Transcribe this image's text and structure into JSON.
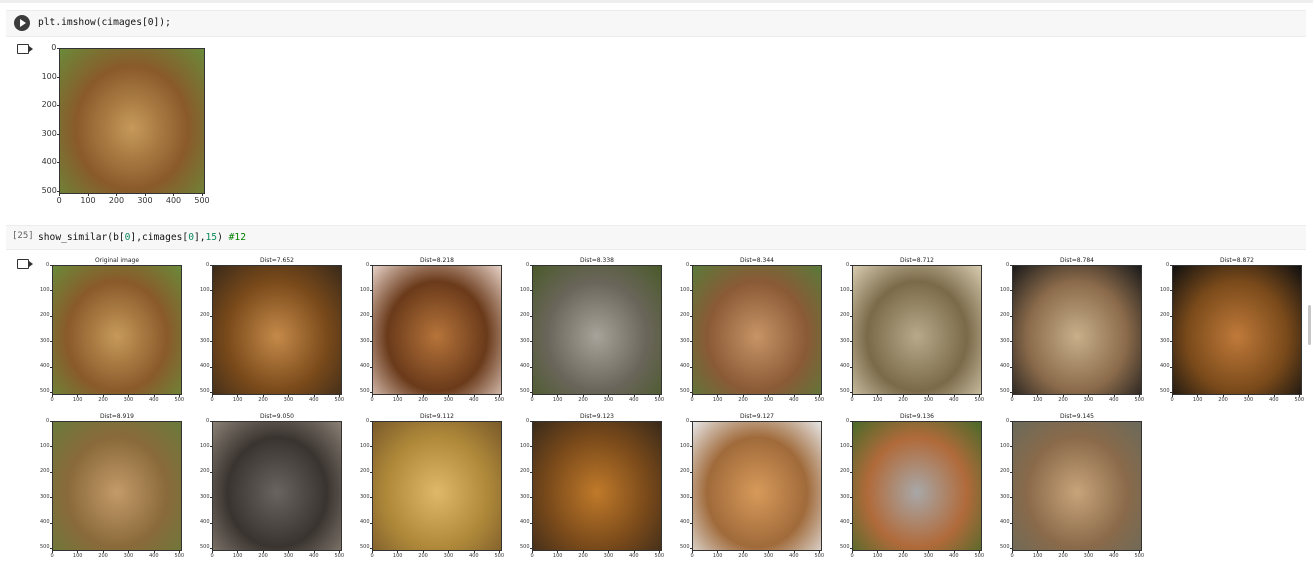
{
  "cells": [
    {
      "execution_count": "",
      "code": "plt.imshow(cimages[0]);",
      "output": {
        "title": "",
        "x_ticks": [
          "0",
          "100",
          "200",
          "300",
          "400",
          "500"
        ],
        "y_ticks": [
          "0",
          "100",
          "200",
          "300",
          "400",
          "500"
        ]
      }
    },
    {
      "execution_count": "[25]",
      "code_parts": {
        "fn": "show_similar(b[",
        "i1": "0",
        "mid": "],cimages[",
        "i2": "0",
        "end": "],",
        "n": "15",
        "close": ")",
        "comment": "#12"
      },
      "plots": [
        {
          "title": "Original image",
          "palette": [
            "#c69a5a",
            "#8a5a2a",
            "#6a8a3a"
          ]
        },
        {
          "title": "Dist=7.652",
          "palette": [
            "#c58a4a",
            "#7a4a1a",
            "#3a2a1a"
          ]
        },
        {
          "title": "Dist=8.218",
          "palette": [
            "#b6743a",
            "#6a3a1a",
            "#e7d2c8"
          ]
        },
        {
          "title": "Dist=8.338",
          "palette": [
            "#a7a39a",
            "#6a655a",
            "#4a5a2a"
          ]
        },
        {
          "title": "Dist=8.344",
          "palette": [
            "#c79466",
            "#8a5a36",
            "#5a7a3a"
          ]
        },
        {
          "title": "Dist=8.712",
          "palette": [
            "#b7a98a",
            "#7a6a4a",
            "#d8ccb0"
          ]
        },
        {
          "title": "Dist=8.784",
          "palette": [
            "#c8b08a",
            "#8a6a4a",
            "#1a1a1a"
          ]
        },
        {
          "title": "Dist=8.872",
          "palette": [
            "#c07a3a",
            "#7a4a1a",
            "#101010"
          ]
        },
        {
          "title": "Dist=8.919",
          "palette": [
            "#c49a6a",
            "#8a6a3a",
            "#6a7a3a"
          ]
        },
        {
          "title": "Dist=9.050",
          "palette": [
            "#6a6460",
            "#3a3430",
            "#8a8075"
          ]
        },
        {
          "title": "Dist=9.112",
          "palette": [
            "#e0b86a",
            "#b08a3a",
            "#7a5a2a"
          ]
        },
        {
          "title": "Dist=9.123",
          "palette": [
            "#c07a2a",
            "#7a4a1a",
            "#3a2a1a"
          ]
        },
        {
          "title": "Dist=9.127",
          "palette": [
            "#d79a5a",
            "#a06a3a",
            "#e6e6e6"
          ]
        },
        {
          "title": "Dist=9.136",
          "palette": [
            "#a8a8a8",
            "#b06a3a",
            "#4a6a2a"
          ]
        },
        {
          "title": "Dist=9.145",
          "palette": [
            "#c8a47a",
            "#8a6a4a",
            "#6a6a5a"
          ]
        }
      ],
      "x_ticks": [
        "0",
        "100",
        "200",
        "300",
        "400",
        "500"
      ],
      "y_ticks": [
        "0",
        "100",
        "200",
        "300",
        "400",
        "500"
      ]
    }
  ],
  "colors": {
    "cell_bg": "#f7f7f7",
    "comment": "#008000",
    "number": "#09885a"
  },
  "icons": {
    "run": "play-circle-icon",
    "output": "output-arrow-icon"
  }
}
